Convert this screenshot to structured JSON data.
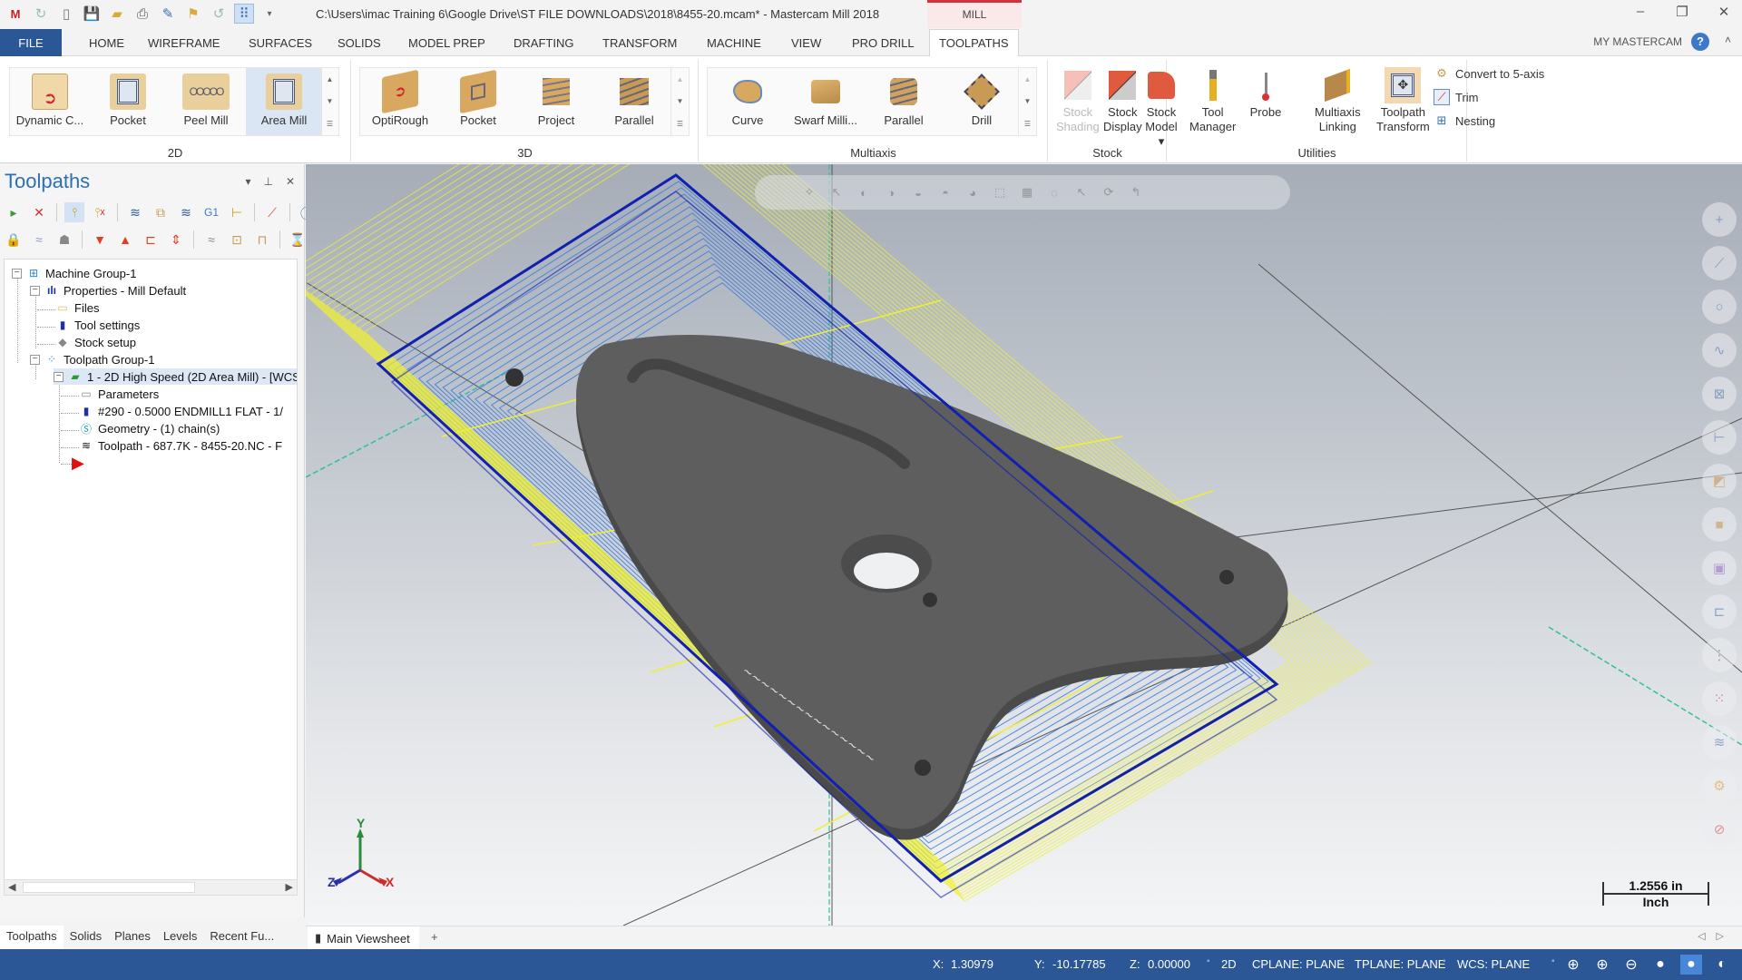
{
  "window": {
    "title": "C:\\Users\\imac Training 6\\Google Drive\\ST FILE DOWNLOADS\\2018\\8455-20.mcam* - Mastercam Mill 2018",
    "context_tab": "MILL",
    "minimize": "–",
    "restore": "❐",
    "close": "✕"
  },
  "quick_access": [
    "app-logo",
    "redo-icon",
    "new-icon",
    "save-icon",
    "open-icon",
    "print-icon",
    "save-as-icon",
    "folder-icon",
    "undo-icon",
    "select-icon",
    "customize-icon"
  ],
  "ribbon_tabs": [
    {
      "label": "FILE"
    },
    {
      "label": "HOME"
    },
    {
      "label": "WIREFRAME"
    },
    {
      "label": "SURFACES"
    },
    {
      "label": "SOLIDS"
    },
    {
      "label": "MODEL PREP"
    },
    {
      "label": "DRAFTING"
    },
    {
      "label": "TRANSFORM"
    },
    {
      "label": "MACHINE"
    },
    {
      "label": "VIEW"
    },
    {
      "label": "PRO DRILL"
    },
    {
      "label": "TOOLPATHS",
      "active": true
    }
  ],
  "my_mastercam": "MY MASTERCAM",
  "help": "?",
  "ribbon": {
    "group_2d": {
      "label": "2D",
      "buttons": [
        "Dynamic C...",
        "Pocket",
        "Peel Mill",
        "Area Mill"
      ],
      "selected": "Area Mill"
    },
    "group_3d": {
      "label": "3D",
      "buttons": [
        "OptiRough",
        "Pocket",
        "Project",
        "Parallel"
      ]
    },
    "group_multiaxis": {
      "label": "Multiaxis",
      "buttons": [
        "Curve",
        "Swarf Milli...",
        "Parallel",
        "Drill"
      ]
    },
    "group_stock": {
      "label": "Stock",
      "buttons": [
        {
          "line1": "Stock",
          "line2": "Shading",
          "disabled": true
        },
        {
          "line1": "Stock",
          "line2": "Display"
        },
        {
          "line1": "Stock",
          "line2": "Model ▾"
        }
      ]
    },
    "group_utilities": {
      "label": "Utilities",
      "buttons": [
        {
          "line1": "Tool",
          "line2": "Manager"
        },
        {
          "line1": "Probe",
          "line2": ""
        },
        {
          "line1": "Multiaxis",
          "line2": "Linking"
        },
        {
          "line1": "Toolpath",
          "line2": "Transform"
        }
      ],
      "small": [
        "Convert to 5-axis",
        "Trim",
        "Nesting"
      ]
    }
  },
  "toolpaths_panel": {
    "title": "Toolpaths",
    "controls": [
      "▾",
      "⊥",
      "✕"
    ],
    "tree": [
      {
        "label": "Machine Group-1",
        "icon": "machine-group-icon"
      },
      {
        "label": "Properties - Mill Default",
        "icon": "properties-icon"
      },
      {
        "label": "Files",
        "icon": "folder-icon"
      },
      {
        "label": "Tool settings",
        "icon": "tool-icon"
      },
      {
        "label": "Stock setup",
        "icon": "stock-icon"
      },
      {
        "label": "Toolpath Group-1",
        "icon": "toolpath-group-icon"
      },
      {
        "label": "1 - 2D High Speed (2D Area Mill) - [WCS",
        "icon": "operation-icon",
        "selected": true
      },
      {
        "label": "Parameters",
        "icon": "parameters-icon"
      },
      {
        "label": "#290 - 0.5000 ENDMILL1 FLAT - 1/",
        "icon": "endmill-icon"
      },
      {
        "label": "Geometry -  (1) chain(s)",
        "icon": "geometry-icon"
      },
      {
        "label": "Toolpath - 687.7K - 8455-20.NC - F",
        "icon": "toolpath-icon"
      }
    ]
  },
  "bottom_tabs": [
    {
      "label": "Toolpaths",
      "active": true
    },
    {
      "label": "Solids"
    },
    {
      "label": "Planes"
    },
    {
      "label": "Levels"
    },
    {
      "label": "Recent Fu..."
    }
  ],
  "viewsheet": {
    "tab": "Main Viewsheet",
    "add": "+"
  },
  "viewport": {
    "scale_value": "1.2556 in",
    "scale_unit": "Inch",
    "gnomon": {
      "x": "X",
      "y": "Y",
      "z": "Z"
    },
    "colors": {
      "toolpath_feed": "#3a7be0",
      "toolpath_rapid": "#f0f030",
      "boundary": "#1020b0",
      "part": "#5a5a5a"
    }
  },
  "status": {
    "x_label": "X:",
    "x": "1.30979",
    "y_label": "Y:",
    "y": "-10.17785",
    "z_label": "Z:",
    "z": "0.00000",
    "mode": "2D",
    "cplane": "CPLANE: PLANE",
    "tplane": "TPLANE: PLANE",
    "wcs": "WCS: PLANE"
  },
  "colors": {
    "accent": "#2b5797",
    "context_red": "#d1343c",
    "panel_title": "#2b6fb8"
  }
}
